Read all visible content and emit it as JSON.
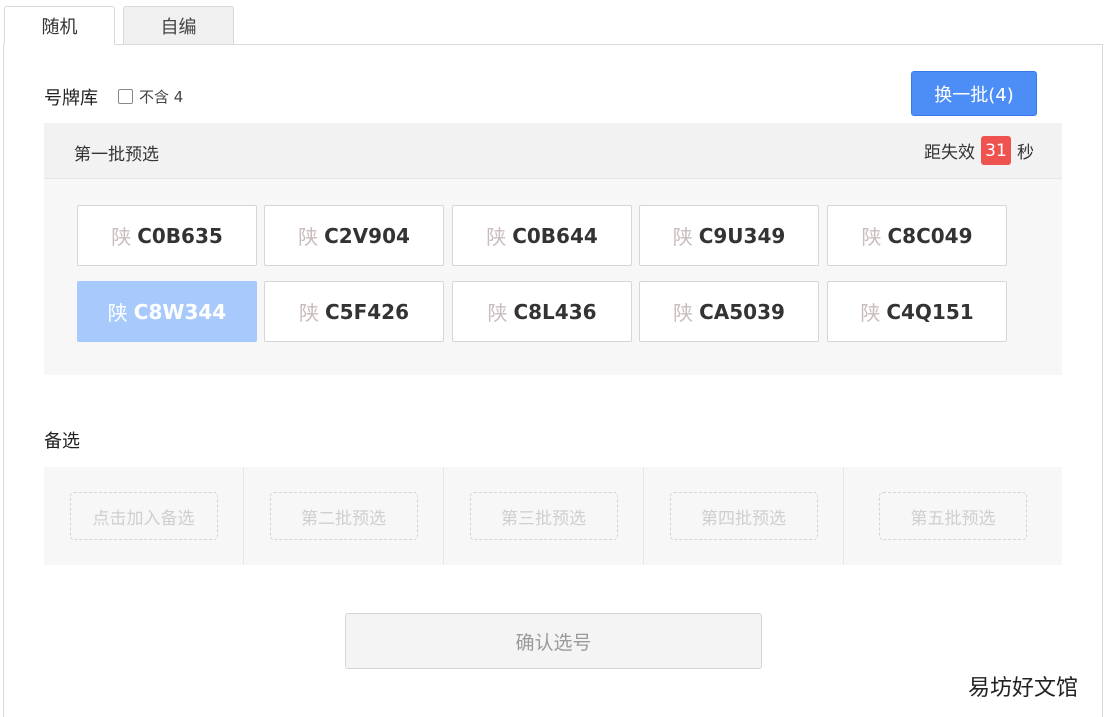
{
  "tabs": [
    {
      "label": "随机",
      "active": true
    },
    {
      "label": "自编",
      "active": false
    }
  ],
  "library": {
    "title": "号牌库",
    "exclude_four_label": "不含 4",
    "exclude_four_checked": false,
    "refresh_label": "换一批(4)"
  },
  "batch": {
    "title": "第一批预选",
    "countdown_prefix": "距失效",
    "countdown_value": "31",
    "countdown_suffix": "秒",
    "plates": [
      {
        "prov": "陕",
        "num": "C0B635",
        "selected": false
      },
      {
        "prov": "陕",
        "num": "C2V904",
        "selected": false
      },
      {
        "prov": "陕",
        "num": "C0B644",
        "selected": false
      },
      {
        "prov": "陕",
        "num": "C9U349",
        "selected": false
      },
      {
        "prov": "陕",
        "num": "C8C049",
        "selected": false
      },
      {
        "prov": "陕",
        "num": "C8W344",
        "selected": true
      },
      {
        "prov": "陕",
        "num": "C5F426",
        "selected": false
      },
      {
        "prov": "陕",
        "num": "C8L436",
        "selected": false
      },
      {
        "prov": "陕",
        "num": "CA5039",
        "selected": false
      },
      {
        "prov": "陕",
        "num": "C4Q151",
        "selected": false
      }
    ]
  },
  "alternates": {
    "title": "备选",
    "slots": [
      "点击加入备选",
      "第二批预选",
      "第三批预选",
      "第四批预选",
      "第五批预选"
    ]
  },
  "confirm_label": "确认选号",
  "watermark": "易坊好文馆",
  "colors": {
    "primary": "#4d8ef6",
    "selected_plate": "#a8c9fb",
    "countdown_badge": "#ef5350"
  }
}
